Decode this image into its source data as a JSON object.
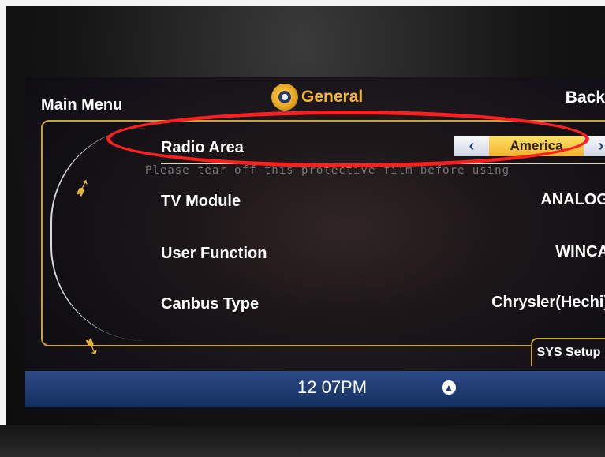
{
  "header": {
    "left_label": "Main Menu",
    "title": "General",
    "right_label": "Back",
    "title_icon": "gear-icon"
  },
  "film_notice": "Please tear off this protective film before using",
  "settings": [
    {
      "label": "Radio Area",
      "value": "America"
    },
    {
      "label": "TV Module",
      "value": "ANALOG"
    },
    {
      "label": "User Function",
      "value": "WINCA"
    },
    {
      "label": "Canbus Type",
      "value": "Chrysler(Hechi)"
    }
  ],
  "selector": {
    "left_arrow": "‹",
    "right_arrow": "›"
  },
  "side_tab": "SYS Setup",
  "status": {
    "time": "12 07PM",
    "up_icon": "chevron-up-icon"
  },
  "colors": {
    "accent": "#e2b53a",
    "annotation": "#ff1f1f"
  }
}
